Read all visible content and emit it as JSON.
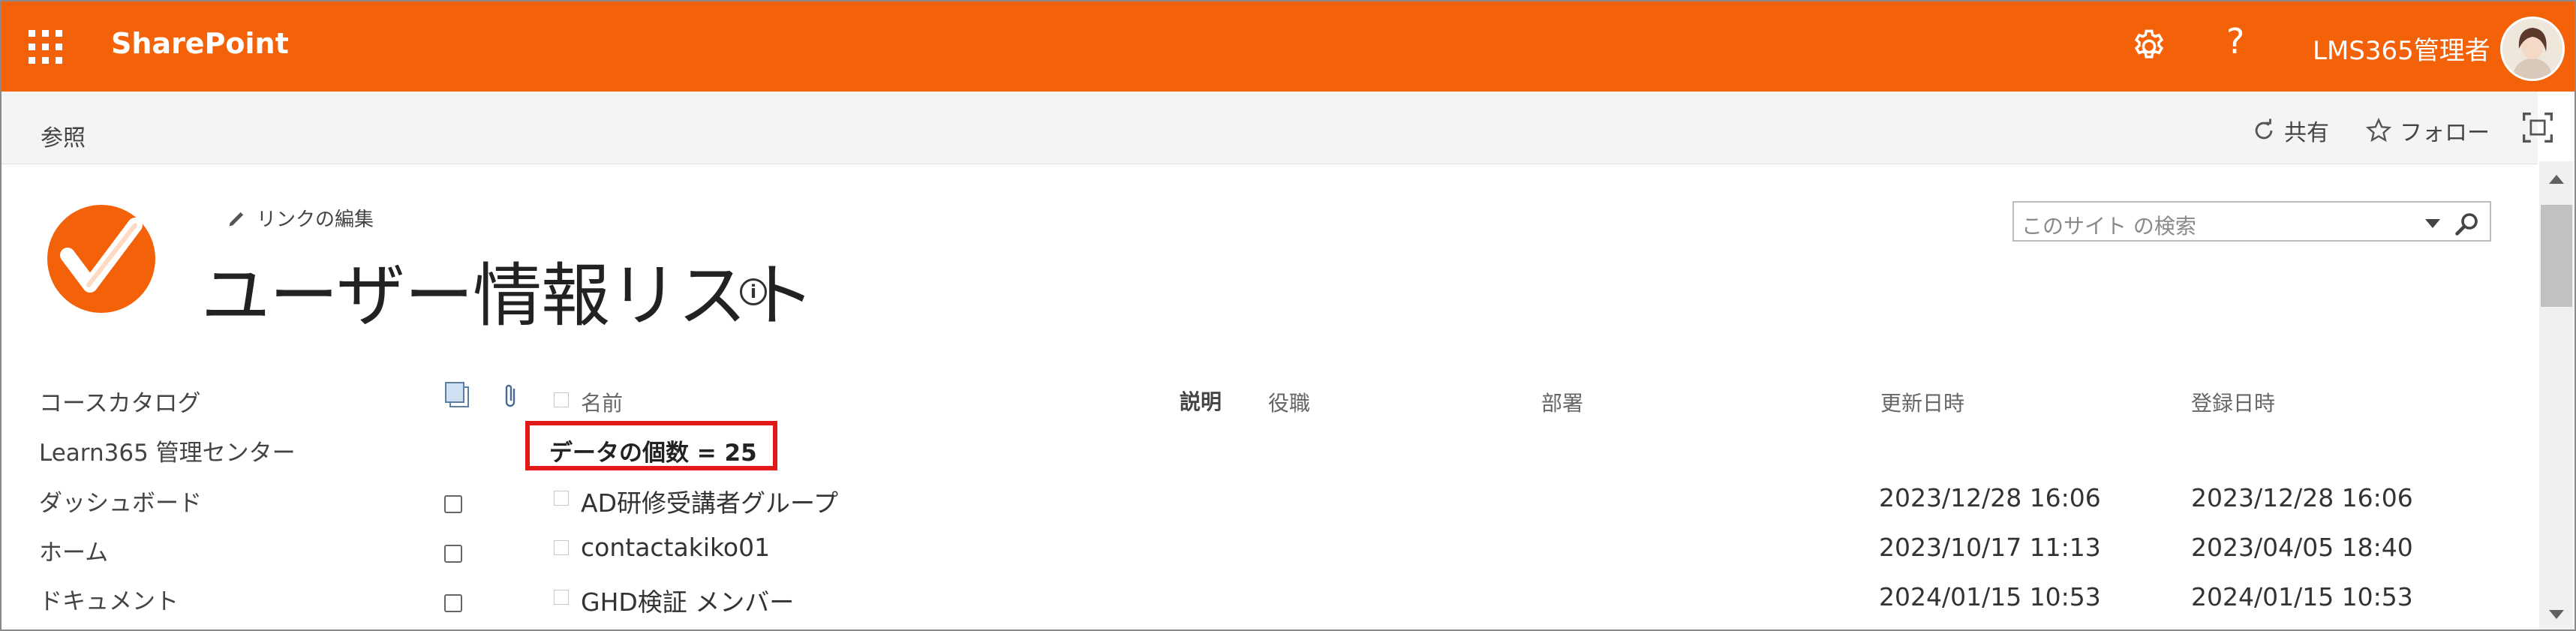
{
  "suitebar": {
    "brand": "SharePoint",
    "user_name": "LMS365管理者",
    "accent": "#f36209"
  },
  "ribbon": {
    "tab_browse": "参照",
    "share": "共有",
    "follow": "フォロー"
  },
  "header": {
    "edit_links": "リンクの編集",
    "title": "ユーザー情報リスト",
    "search_placeholder": "このサイト の検索"
  },
  "quick_launch": [
    "コースカタログ",
    "Learn365 管理センター",
    "ダッシュボード",
    "ホーム",
    "ドキュメント"
  ],
  "list": {
    "columns": {
      "name": "名前",
      "description": "説明",
      "role": "役職",
      "department": "部署",
      "modified": "更新日時",
      "created": "登録日時"
    },
    "item_count": "データの個数 = 25",
    "rows": [
      {
        "name": "AD研修受講者グループ",
        "modified": "2023/12/28 16:06",
        "created": "2023/12/28 16:06"
      },
      {
        "name": "contactakiko01",
        "modified": "2023/10/17 11:13",
        "created": "2023/04/05 18:40"
      },
      {
        "name": "GHD検証 メンバー",
        "modified": "2024/01/15 10:53",
        "created": "2024/01/15 10:53"
      }
    ]
  }
}
